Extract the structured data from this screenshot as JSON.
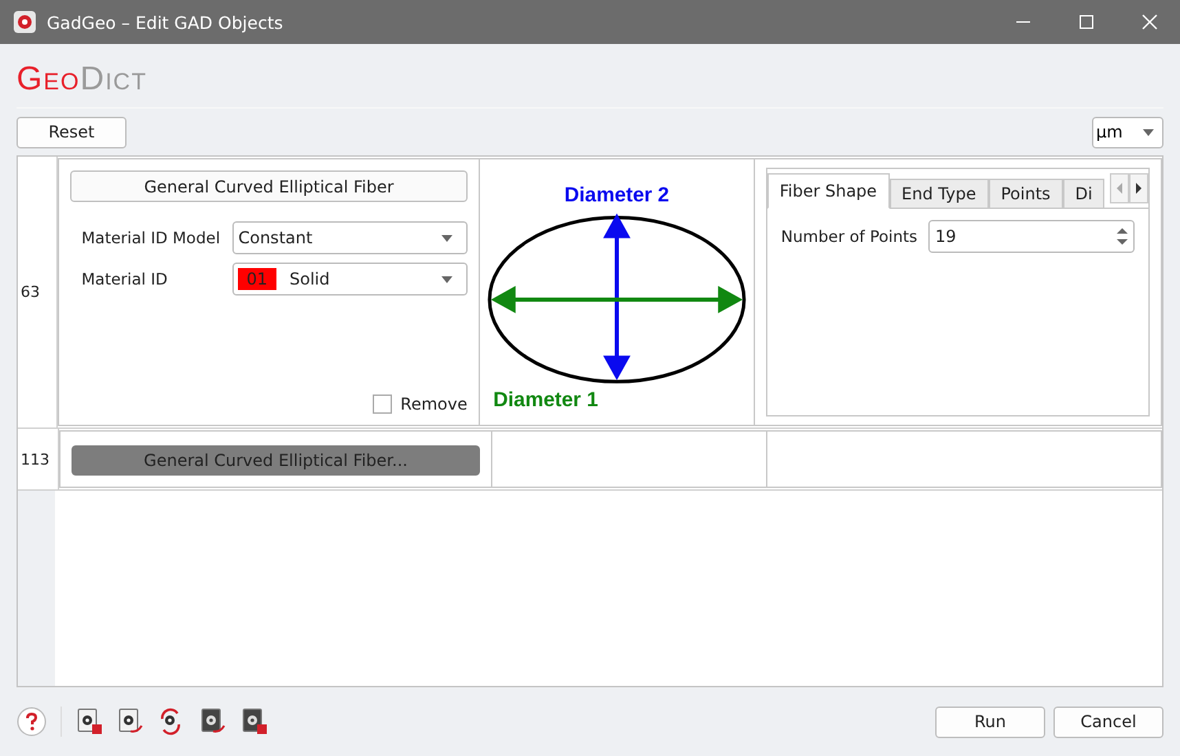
{
  "window": {
    "title": "GadGeo – Edit GAD Objects"
  },
  "logo": {
    "first": "Geo",
    "second": "Dict"
  },
  "toolbar": {
    "reset": "Reset",
    "unit": "µm"
  },
  "rows": [
    {
      "header": "63",
      "expanded": true,
      "object": "General Curved Elliptical Fiber",
      "fields": [
        {
          "label": "Material ID Model",
          "value": "Constant"
        },
        {
          "label": "Material ID",
          "badge": "01",
          "value": "Solid"
        }
      ],
      "remove": {
        "label": "Remove",
        "checked": false
      },
      "diagram": {
        "label_top": "Diameter 2",
        "label_bottom": "Diameter 1"
      },
      "tabs": [
        {
          "label": "Fiber Shape",
          "selected": true
        },
        {
          "label": "End Type",
          "selected": false
        },
        {
          "label": "Points",
          "selected": false
        },
        {
          "label": "Di",
          "selected": false
        }
      ],
      "spin": {
        "label": "Number of Points",
        "value": "19"
      }
    },
    {
      "header": "113",
      "expanded": false,
      "object": "General Curved Elliptical Fiber..."
    }
  ],
  "buttons": [
    "Run",
    "Cancel"
  ]
}
